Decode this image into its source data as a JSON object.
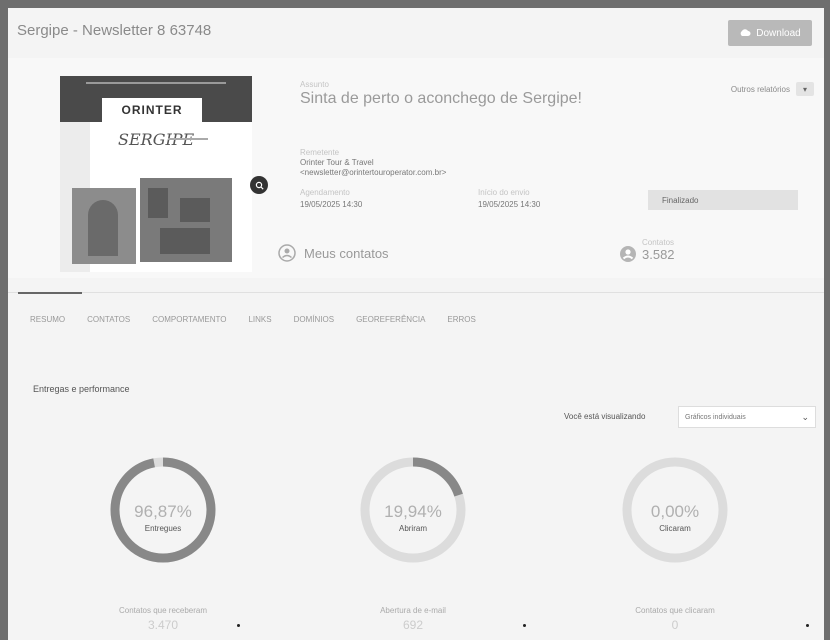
{
  "header": {
    "title": "Sergipe - Newsletter 8 63748",
    "download_label": "Download"
  },
  "summary": {
    "thumb_logo": "ORINTER",
    "thumb_script": "SERGIPE",
    "subject_label": "Assunto",
    "subject": "Sinta de perto o aconchego de Sergipe!",
    "reports_label": "Outros relatórios",
    "sender_label": "Remetente",
    "sender_name": "Orinter Tour & Travel",
    "sender_email": "<newsletter@orintertouroperator.com.br>",
    "scheduled_label": "Agendamento",
    "scheduled_value": "19/05/2025 14:30",
    "sent_label": "Início do envio",
    "sent_value": "19/05/2025 14:30",
    "status_value": "Finalizado",
    "list_label": "Meus contatos",
    "recipients_label": "Contatos",
    "recipients_value": "3.582"
  },
  "tabs": [
    "RESUMO",
    "CONTATOS",
    "COMPORTAMENTO",
    "LINKS",
    "DOMÍNIOS",
    "GEOREFERÊNCIA",
    "ERROS"
  ],
  "performance": {
    "title": "Entregas e performance",
    "view_label": "Você está visualizando",
    "view_value": "Gráficos individuais",
    "metrics": [
      {
        "pct": "96,87%",
        "name": "Entregues",
        "fraction": 0.9687,
        "foot_label": "Contatos que receberam",
        "foot_value": "3.470"
      },
      {
        "pct": "19,94%",
        "name": "Abriram",
        "fraction": 0.1994,
        "foot_label": "Abertura de e-mail",
        "foot_value": "692"
      },
      {
        "pct": "0,00%",
        "name": "Clicaram",
        "fraction": 0.0,
        "foot_label": "Contatos que clicaram",
        "foot_value": "0"
      }
    ]
  },
  "colors": {
    "ring": "#888888",
    "ring_track": "#dcdcdc",
    "status_bg": "#e2e2e2"
  }
}
